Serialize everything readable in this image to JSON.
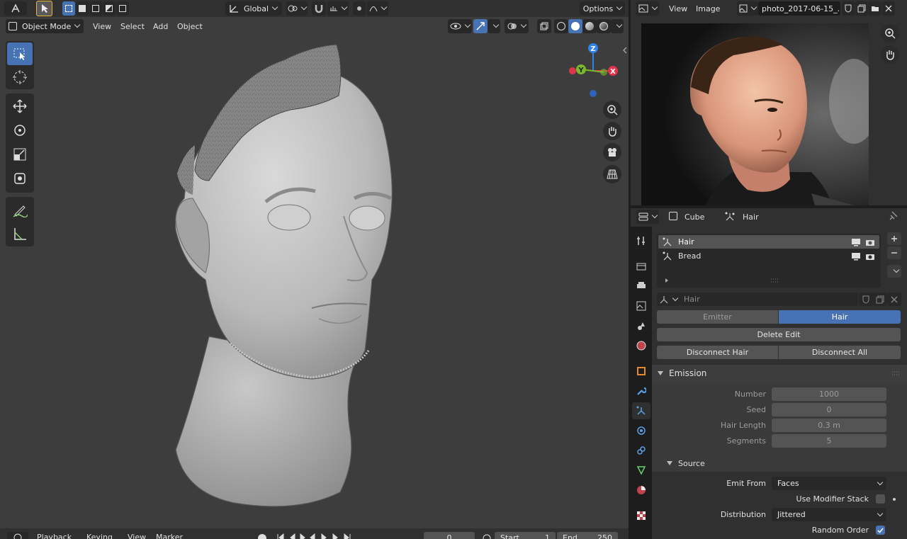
{
  "viewport": {
    "header": {
      "transform_orientation": "Global",
      "options_label": "Options"
    },
    "subheader": {
      "mode": "Object Mode",
      "menus": [
        "View",
        "Select",
        "Add",
        "Object"
      ]
    },
    "gizmo": {
      "z": "Z",
      "y": "Y",
      "x": "X"
    }
  },
  "image_editor": {
    "menus": [
      "View",
      "Image"
    ],
    "image_name": "photo_2017-06-15_..."
  },
  "properties": {
    "breadcrumb_object": "Cube",
    "breadcrumb_data": "Hair",
    "particle_systems": [
      {
        "name": "Hair"
      },
      {
        "name": "Bread"
      }
    ],
    "settings_name": "Hair",
    "type_options": [
      "Emitter",
      "Hair"
    ],
    "buttons": {
      "delete_edit": "Delete Edit",
      "disconnect_hair": "Disconnect Hair",
      "disconnect_all": "Disconnect All"
    },
    "emission": {
      "title": "Emission",
      "fields": [
        {
          "label": "Number",
          "value": "1000"
        },
        {
          "label": "Seed",
          "value": "0"
        },
        {
          "label": "Hair Length",
          "value": "0.3 m"
        },
        {
          "label": "Segments",
          "value": "5"
        }
      ]
    },
    "source": {
      "title": "Source",
      "emit_from_label": "Emit From",
      "emit_from_value": "Faces",
      "use_modifier_stack_label": "Use Modifier Stack",
      "distribution_label": "Distribution",
      "distribution_value": "Jittered",
      "random_order_label": "Random Order"
    }
  },
  "timeline": {
    "menus": [
      "Playback",
      "Keying",
      "View",
      "Marker"
    ],
    "current_frame": "0",
    "start_label": "Start",
    "start_value": "1",
    "end_label": "End",
    "end_value": "250"
  },
  "colors": {
    "accent": "#4772b3",
    "axis_x": "#e0344d",
    "axis_y": "#7cb72a",
    "axis_z": "#2f82e8"
  }
}
